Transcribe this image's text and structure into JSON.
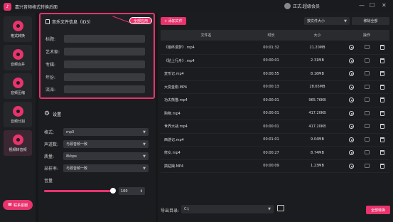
{
  "window": {
    "title": "嘉兴音频格式转换后面",
    "user": "正式:超级会员",
    "minimize": "—",
    "restore": "☐",
    "close": "✕"
  },
  "sidebar": {
    "items": [
      {
        "label": "格式转换"
      },
      {
        "label": "音频合并"
      },
      {
        "label": "音频压缩"
      },
      {
        "label": "音频分割"
      },
      {
        "label": "视频转音频"
      }
    ],
    "service_label": "联系客服"
  },
  "metadata": {
    "title": "音乐文件信息（ID3）",
    "tag_button": "全部应用",
    "fields": [
      {
        "label": "标题:",
        "value": ""
      },
      {
        "label": "艺术家:",
        "value": ""
      },
      {
        "label": "专辑:",
        "value": ""
      },
      {
        "label": "年份:",
        "value": ""
      },
      {
        "label": "流派:",
        "value": ""
      }
    ]
  },
  "settings": {
    "title": "设置",
    "rows": [
      {
        "label": "格式:",
        "value": "mp3"
      },
      {
        "label": "声道数:",
        "value": "与源音频一致"
      },
      {
        "label": "质量:",
        "value": "8kbps"
      },
      {
        "label": "采样率:",
        "value": "与源音频一致"
      }
    ],
    "volume_label": "音量",
    "volume_value": "100",
    "volume_fraction": 1.0,
    "caret": "▼",
    "spin": "⇕"
  },
  "main": {
    "add_button": "+ 添加文件",
    "sort_select": "按文件大小",
    "clear_button": "移除全部",
    "columns": [
      "文件名",
      "时长",
      "大小",
      "操作"
    ],
    "rows": [
      {
        "name": "《最终漫梦》.mp4",
        "duration": "00:01:32",
        "size": "21.20MB"
      },
      {
        "name": "《贴上行舟》.mp4",
        "duration": "00:00:01",
        "size": "2.31MB"
      },
      {
        "name": "変形记.mp4",
        "duration": "00:00:55",
        "size": "8.16MB"
      },
      {
        "name": "大变金刚.MP4",
        "duration": "00:00:13",
        "size": "28.65MB"
      },
      {
        "name": "功夫熊猫.mp4",
        "duration": "00:00:01",
        "size": "965.76KB"
      },
      {
        "name": "购物.mp4",
        "duration": "00:00:01",
        "size": "417.20KB"
      },
      {
        "name": "世界大战.mp4",
        "duration": "00:00:01",
        "size": "417.20KB"
      },
      {
        "name": "西游记.mp4",
        "duration": "00:01:01",
        "size": "9.04MB"
      },
      {
        "name": "修女.mp4",
        "duration": "00:00:27",
        "size": "8.74MB"
      },
      {
        "name": "搞姑娘.MP4",
        "duration": "00:00:09",
        "size": "1.23MB"
      }
    ],
    "output_label": "导出目录:",
    "output_path": "C:\\",
    "convert_all": "全部转换"
  },
  "colors": {
    "accent": "#e8336d",
    "background": "#161719"
  }
}
